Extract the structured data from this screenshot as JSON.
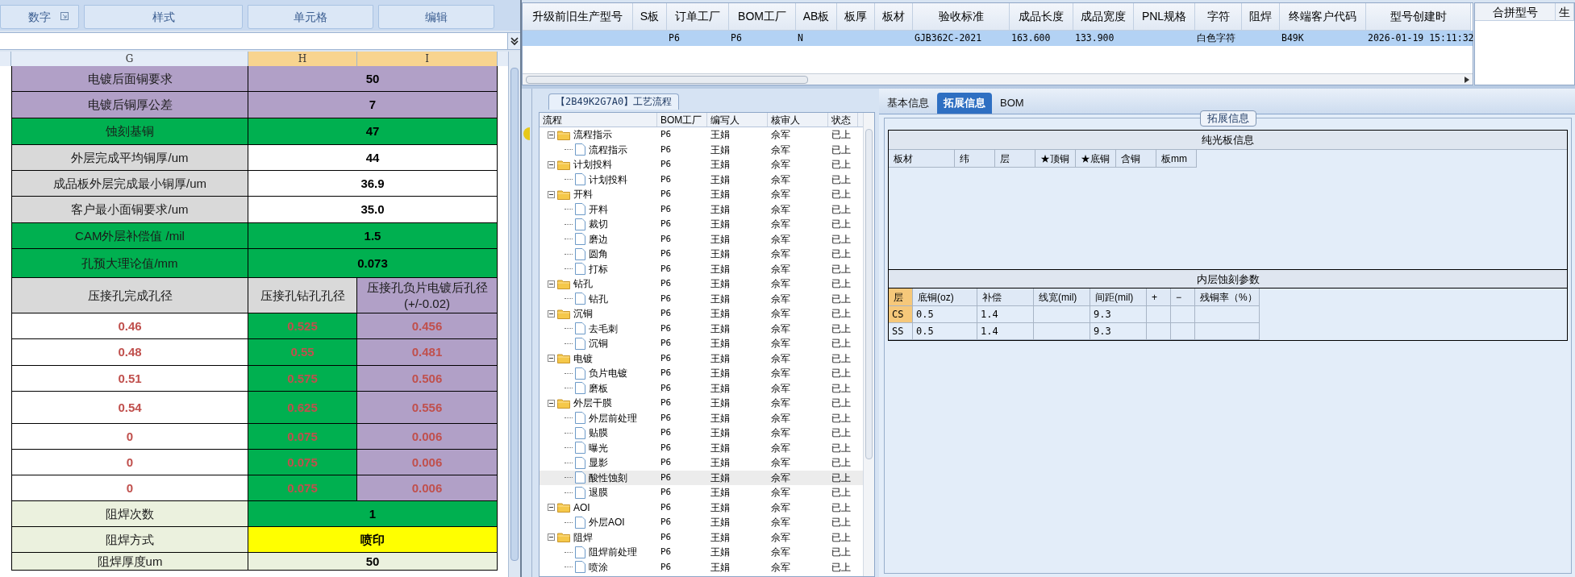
{
  "excel": {
    "ribbon_groups": [
      {
        "label": "数字"
      },
      {
        "label": "样式"
      },
      {
        "label": "单元格"
      },
      {
        "label": "编辑"
      }
    ],
    "columns": [
      {
        "label": "G",
        "selected": false
      },
      {
        "label": "H",
        "selected": true
      },
      {
        "label": "I",
        "selected": true
      }
    ],
    "rows": [
      {
        "cells": [
          {
            "text": "电镀后面铜要求",
            "kind": "label",
            "color": "#b1a0c7"
          },
          {
            "text": "50",
            "kind": "value",
            "color": "#b1a0c7"
          }
        ]
      },
      {
        "cells": [
          {
            "text": "电镀后铜厚公差",
            "kind": "label",
            "color": "#b1a0c7"
          },
          {
            "text": "7",
            "kind": "value",
            "color": "#b1a0c7"
          }
        ]
      },
      {
        "cells": [
          {
            "text": "蚀刻基铜",
            "kind": "label",
            "color": "#00b050"
          },
          {
            "text": "47",
            "kind": "value",
            "color": "#00b050"
          }
        ]
      },
      {
        "cells": [
          {
            "text": "外层完成平均铜厚/um",
            "kind": "label",
            "color": "#d9d9d9"
          },
          {
            "text": "44",
            "kind": "value",
            "color": "#ffffff"
          }
        ]
      },
      {
        "cells": [
          {
            "text": "成品板外层完成最小铜厚/um",
            "kind": "label",
            "color": "#d9d9d9"
          },
          {
            "text": "36.9",
            "kind": "value",
            "color": "#ffffff"
          }
        ]
      },
      {
        "cells": [
          {
            "text": "客户最小面铜要求/um",
            "kind": "label",
            "color": "#d9d9d9"
          },
          {
            "text": "35.0",
            "kind": "value",
            "color": "#ffffff"
          }
        ]
      },
      {
        "cells": [
          {
            "text": "CAM外层补偿值 /mil",
            "kind": "label",
            "color": "#00b050"
          },
          {
            "text": "1.5",
            "kind": "value",
            "color": "#00b050"
          }
        ]
      },
      {
        "cells": [
          {
            "text": "孔预大理论值/mm",
            "kind": "label",
            "color": "#00b050"
          },
          {
            "text": "0.073",
            "kind": "value",
            "color": "#00b050"
          }
        ]
      },
      {
        "cells": [
          {
            "text": "压接孔完成孔径",
            "kind": "label",
            "color": "#d9d9d9"
          },
          {
            "text": "压接孔钻孔孔径",
            "kind": "label",
            "color": "#d9d9d9"
          },
          {
            "text": "压接孔负片电镀后孔径 (+/-0.02)",
            "kind": "label",
            "color": "#b1a0c7"
          }
        ]
      },
      {
        "cells": [
          {
            "text": "0.46",
            "kind": "measure",
            "color": "#ffffff"
          },
          {
            "text": "0.525",
            "kind": "measure",
            "color": "#00b050"
          },
          {
            "text": "0.456",
            "kind": "measure",
            "color": "#b1a0c7"
          }
        ]
      },
      {
        "cells": [
          {
            "text": "0.48",
            "kind": "measure",
            "color": "#ffffff"
          },
          {
            "text": "0.55",
            "kind": "measure",
            "color": "#00b050"
          },
          {
            "text": "0.481",
            "kind": "measure",
            "color": "#b1a0c7"
          }
        ]
      },
      {
        "cells": [
          {
            "text": "0.51",
            "kind": "measure",
            "color": "#ffffff"
          },
          {
            "text": "0.575",
            "kind": "measure",
            "color": "#00b050"
          },
          {
            "text": "0.506",
            "kind": "measure",
            "color": "#b1a0c7"
          }
        ]
      },
      {
        "cells": [
          {
            "text": "0.54",
            "kind": "measure",
            "color": "#ffffff"
          },
          {
            "text": "0.625",
            "kind": "measure",
            "color": "#00b050"
          },
          {
            "text": "0.556",
            "kind": "measure",
            "color": "#b1a0c7"
          }
        ]
      },
      {
        "cells": [
          {
            "text": "0",
            "kind": "measure",
            "color": "#ffffff"
          },
          {
            "text": "0.075",
            "kind": "measure",
            "color": "#00b050"
          },
          {
            "text": "0.006",
            "kind": "measure",
            "color": "#b1a0c7"
          }
        ]
      },
      {
        "cells": [
          {
            "text": "0",
            "kind": "measure",
            "color": "#ffffff"
          },
          {
            "text": "0.075",
            "kind": "measure",
            "color": "#00b050"
          },
          {
            "text": "0.006",
            "kind": "measure",
            "color": "#b1a0c7"
          }
        ]
      },
      {
        "cells": [
          {
            "text": "0",
            "kind": "measure",
            "color": "#ffffff"
          },
          {
            "text": "0.075",
            "kind": "measure",
            "color": "#00b050"
          },
          {
            "text": "0.006",
            "kind": "measure",
            "color": "#b1a0c7"
          }
        ]
      },
      {
        "cells": [
          {
            "text": "阻焊次数",
            "kind": "label",
            "color": "#ebf1de"
          },
          {
            "text": "1",
            "kind": "value",
            "color": "#00b050"
          }
        ]
      },
      {
        "cells": [
          {
            "text": "阻焊方式",
            "kind": "label",
            "color": "#ebf1de"
          },
          {
            "text": "喷印",
            "kind": "value",
            "color": "#ffff00"
          }
        ]
      },
      {
        "cells": [
          {
            "text": "阻焊厚度um",
            "kind": "label",
            "color": "#ebf1de"
          },
          {
            "text": "50",
            "kind": "value",
            "color": "#ebf1de"
          }
        ]
      }
    ]
  },
  "model_grid": {
    "columns": [
      "升级前旧生产型号",
      "S板",
      "订单工厂",
      "BOM工厂",
      "AB板",
      "板厚",
      "板材",
      "验收标准",
      "成品长度",
      "成品宽度",
      "PNL规格",
      "字符",
      "阻焊",
      "终端客户代码",
      "型号创建时"
    ],
    "rows": [
      {
        "selected": true,
        "cells": [
          null,
          null,
          "P6",
          "P6",
          "N",
          null,
          null,
          "GJB362C-2021",
          "163.600",
          "133.900",
          null,
          "白色字符",
          null,
          "B49K",
          "2026-01-19 15:11:32"
        ]
      }
    ]
  },
  "merge_grid": {
    "columns": [
      "合拼型号",
      "生"
    ]
  },
  "process_panel": {
    "title": "【2B49K2G7A0】工艺流程",
    "columns": [
      "流程",
      "BOM工厂",
      "编写人",
      "核审人",
      "状态"
    ],
    "tree": [
      {
        "label": "流程指示",
        "bom": "P6",
        "writer": "王娟",
        "reviewer": "佘军",
        "status": "已上",
        "selected": false,
        "children": [
          {
            "label": "流程指示",
            "bom": "P6",
            "writer": "王娟",
            "reviewer": "佘军",
            "status": "已上",
            "selected": false
          }
        ]
      },
      {
        "label": "计划投料",
        "bom": "P6",
        "writer": "王娟",
        "reviewer": "佘军",
        "status": "已上",
        "selected": false,
        "children": [
          {
            "label": "计划投料",
            "bom": "P6",
            "writer": "王娟",
            "reviewer": "佘军",
            "status": "已上",
            "selected": false
          }
        ]
      },
      {
        "label": "开料",
        "bom": "P6",
        "writer": "王娟",
        "reviewer": "佘军",
        "status": "已上",
        "selected": false,
        "children": [
          {
            "label": "开料",
            "bom": "P6",
            "writer": "王娟",
            "reviewer": "佘军",
            "status": "已上",
            "selected": false
          },
          {
            "label": "裁切",
            "bom": "P6",
            "writer": "王娟",
            "reviewer": "佘军",
            "status": "已上",
            "selected": false
          },
          {
            "label": "磨边",
            "bom": "P6",
            "writer": "王娟",
            "reviewer": "佘军",
            "status": "已上",
            "selected": false
          },
          {
            "label": "圆角",
            "bom": "P6",
            "writer": "王娟",
            "reviewer": "佘军",
            "status": "已上",
            "selected": false
          },
          {
            "label": "打标",
            "bom": "P6",
            "writer": "王娟",
            "reviewer": "佘军",
            "status": "已上",
            "selected": false
          }
        ]
      },
      {
        "label": "钻孔",
        "bom": "P6",
        "writer": "王娟",
        "reviewer": "佘军",
        "status": "已上",
        "selected": false,
        "children": [
          {
            "label": "钻孔",
            "bom": "P6",
            "writer": "王娟",
            "reviewer": "佘军",
            "status": "已上",
            "selected": false
          }
        ]
      },
      {
        "label": "沉铜",
        "bom": "P6",
        "writer": "王娟",
        "reviewer": "佘军",
        "status": "已上",
        "selected": false,
        "children": [
          {
            "label": "去毛刺",
            "bom": "P6",
            "writer": "王娟",
            "reviewer": "佘军",
            "status": "已上",
            "selected": false
          },
          {
            "label": "沉铜",
            "bom": "P6",
            "writer": "王娟",
            "reviewer": "佘军",
            "status": "已上",
            "selected": false
          }
        ]
      },
      {
        "label": "电镀",
        "bom": "P6",
        "writer": "王娟",
        "reviewer": "佘军",
        "status": "已上",
        "selected": false,
        "children": [
          {
            "label": "负片电镀",
            "bom": "P6",
            "writer": "王娟",
            "reviewer": "佘军",
            "status": "已上",
            "selected": false
          },
          {
            "label": "磨板",
            "bom": "P6",
            "writer": "王娟",
            "reviewer": "佘军",
            "status": "已上",
            "selected": false
          }
        ]
      },
      {
        "label": "外层干膜",
        "bom": "P6",
        "writer": "王娟",
        "reviewer": "佘军",
        "status": "已上",
        "selected": false,
        "children": [
          {
            "label": "外层前处理",
            "bom": "P6",
            "writer": "王娟",
            "reviewer": "佘军",
            "status": "已上",
            "selected": false
          },
          {
            "label": "贴膜",
            "bom": "P6",
            "writer": "王娟",
            "reviewer": "佘军",
            "status": "已上",
            "selected": false
          },
          {
            "label": "曝光",
            "bom": "P6",
            "writer": "王娟",
            "reviewer": "佘军",
            "status": "已上",
            "selected": false
          },
          {
            "label": "显影",
            "bom": "P6",
            "writer": "王娟",
            "reviewer": "佘军",
            "status": "已上",
            "selected": false
          },
          {
            "label": "酸性蚀刻",
            "bom": "P6",
            "writer": "王娟",
            "reviewer": "佘军",
            "status": "已上",
            "selected": true
          },
          {
            "label": "退膜",
            "bom": "P6",
            "writer": "王娟",
            "reviewer": "佘军",
            "status": "已上",
            "selected": false
          }
        ]
      },
      {
        "label": "AOI",
        "bom": "P6",
        "writer": "王娟",
        "reviewer": "佘军",
        "status": "已上",
        "selected": false,
        "children": [
          {
            "label": "外层AOI",
            "bom": "P6",
            "writer": "王娟",
            "reviewer": "佘军",
            "status": "已上",
            "selected": false
          }
        ]
      },
      {
        "label": "阻焊",
        "bom": "P6",
        "writer": "王娟",
        "reviewer": "佘军",
        "status": "已上",
        "selected": false,
        "children": [
          {
            "label": "阻焊前处理",
            "bom": "P6",
            "writer": "王娟",
            "reviewer": "佘军",
            "status": "已上",
            "selected": false
          },
          {
            "label": "喷涂",
            "bom": "P6",
            "writer": "王娟",
            "reviewer": "佘军",
            "status": "已上",
            "selected": false
          }
        ]
      }
    ]
  },
  "detail_panel": {
    "tabs": [
      {
        "label": "基本信息",
        "selected": false
      },
      {
        "label": "拓展信息",
        "selected": true
      },
      {
        "label": "BOM",
        "selected": false
      }
    ],
    "group_title": "拓展信息",
    "board_section": {
      "title": "纯光板信息",
      "columns": [
        "板材",
        "纬",
        "层",
        "★顶铜",
        "★底铜",
        "含铜",
        "板mm"
      ]
    },
    "etch_section": {
      "title": "内层蚀刻参数",
      "columns": [
        "层",
        "底铜(oz)",
        "补偿",
        "线宽(mil)",
        "间距(mil)",
        "+",
        "−",
        "残铜率（%）"
      ],
      "rows": [
        {
          "selected": true,
          "cells": [
            "CS",
            "0.5",
            "1.4",
            null,
            "9.3",
            null,
            null,
            null
          ]
        },
        {
          "selected": false,
          "cells": [
            "SS",
            "0.5",
            "1.4",
            null,
            "9.3",
            null,
            null,
            null
          ]
        }
      ]
    }
  }
}
